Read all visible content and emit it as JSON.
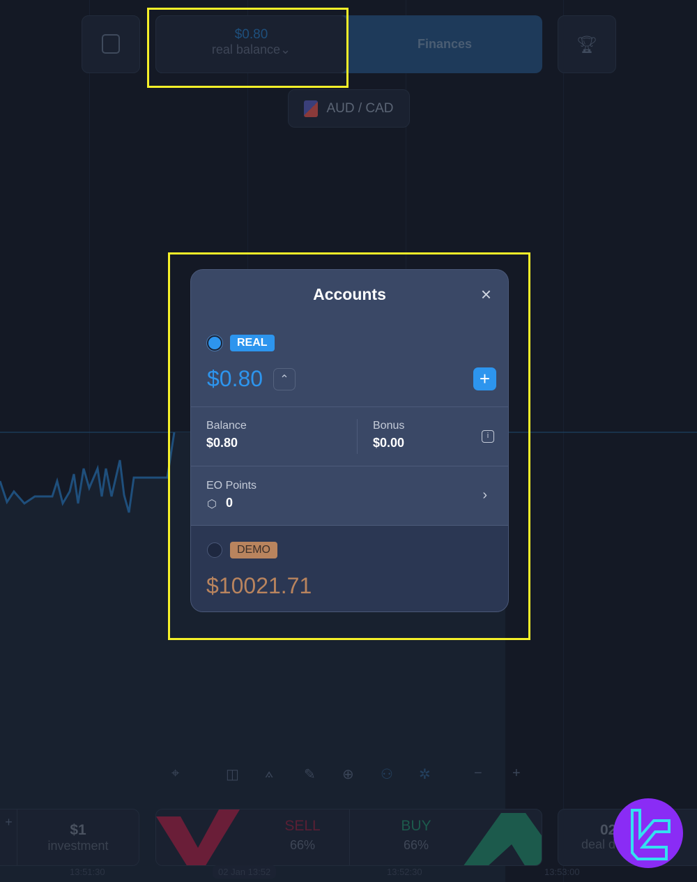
{
  "header": {
    "balance_value": "$0.80",
    "balance_label": "real balance",
    "finances_label": "Finances",
    "asset": "AUD / CAD"
  },
  "modal": {
    "title": "Accounts",
    "real": {
      "badge": "REAL",
      "amount": "$0.80",
      "balance_label": "Balance",
      "balance_value": "$0.80",
      "bonus_label": "Bonus",
      "bonus_value": "$0.00",
      "points_label": "EO Points",
      "points_value": "0",
      "selected": true
    },
    "demo": {
      "badge": "DEMO",
      "amount": "$10021.71",
      "selected": false
    }
  },
  "bottom": {
    "investment_value": "$1",
    "investment_label": "investment",
    "sell_label": "SELL",
    "sell_pct": "66%",
    "buy_label": "BUY",
    "buy_pct": "66%",
    "deal_value": "02",
    "deal_label": "deal d"
  },
  "time_axis": [
    "13:51:30",
    "02 Jan 13:52",
    "13:52:30",
    "13:53:00"
  ],
  "colors": {
    "accent": "#2d95ee",
    "demo": "#b9845e",
    "sell": "#7a1f3a",
    "buy": "#1f6a5a",
    "highlight": "#f5f029"
  }
}
